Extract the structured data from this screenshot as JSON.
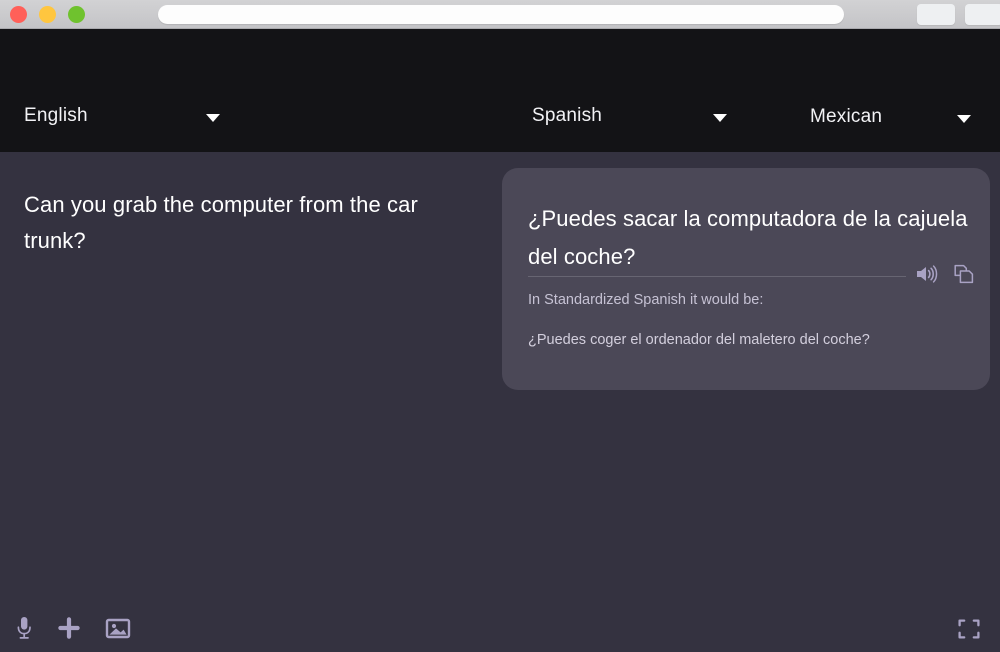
{
  "window": {
    "traffic_lights": [
      {
        "name": "close",
        "color": "#ff6059"
      },
      {
        "name": "minimize",
        "color": "#ffc63f"
      },
      {
        "name": "maximize",
        "color": "#6fc22e"
      }
    ],
    "url_value": "",
    "url_placeholder": "",
    "toolbar_buttons": [
      "",
      ""
    ]
  },
  "language_bar": {
    "source": {
      "label": "English",
      "caret_icon": "chevron-down-icon"
    },
    "target": {
      "label": "Spanish",
      "caret_icon": "chevron-down-icon"
    },
    "dialect": {
      "label": "Mexican",
      "caret_icon": "chevron-down-icon"
    }
  },
  "main": {
    "source_text": "Can you grab the computer from the car trunk?",
    "translation": {
      "primary": "¿Puedes sacar la computadora de la cajuela del coche?",
      "note_label": "In Standardized Spanish it would be:",
      "alternate": "¿Puedes coger el ordenador del maletero del coche?",
      "actions": [
        {
          "name": "speak-icon",
          "label": "Listen"
        },
        {
          "name": "copy-icon",
          "label": "Copy"
        }
      ]
    }
  },
  "toolbar": {
    "left_items": [
      {
        "name": "microphone-icon",
        "label": "Voice input"
      },
      {
        "name": "plus-icon",
        "label": "Add"
      },
      {
        "name": "image-icon",
        "label": "Image input"
      }
    ],
    "right_items": [
      {
        "name": "fullscreen-icon",
        "label": "Expand"
      }
    ]
  },
  "colors": {
    "titlebar": "#c9c9cb",
    "header": "#131316",
    "background": "#343240",
    "card": "#4b4857",
    "icon": "#a9a2c4",
    "text_primary": "#ffffff",
    "text_secondary": "#c6c2d4"
  }
}
